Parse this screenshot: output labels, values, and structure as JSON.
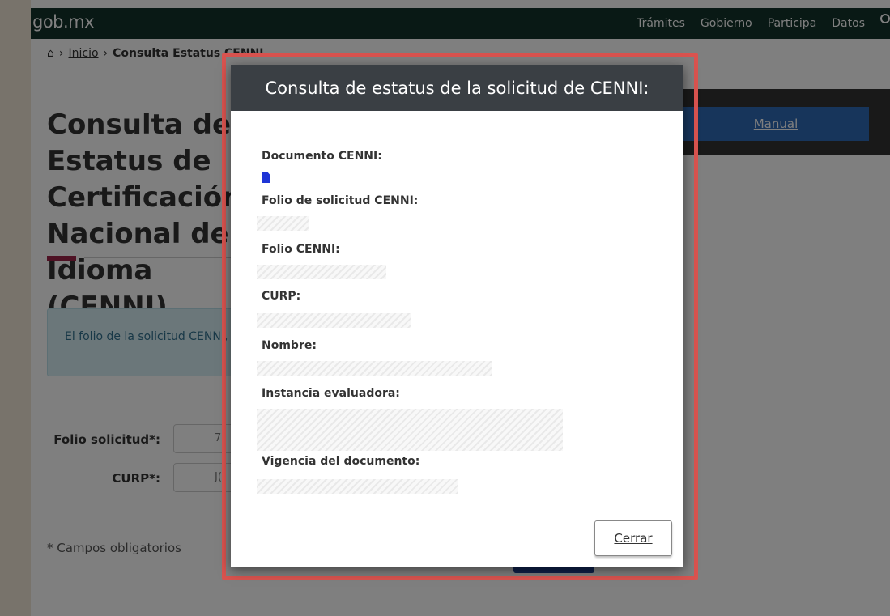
{
  "header": {
    "logo": "gob.mx",
    "nav": [
      "Trámites",
      "Gobierno",
      "Participa",
      "Datos"
    ]
  },
  "breadcrumb": {
    "home": "Inicio",
    "current": "Consulta Estatus CENNI"
  },
  "page": {
    "title": "Consulta de Estatus de Certificación Nacional de Idioma (CENNI)",
    "manual_link": "Manual",
    "info_text": "El folio de la solicitud CENNI, se",
    "folio_label": "Folio solicitud*:",
    "folio_value": "7",
    "curp_label": "CURP*:",
    "curp_value": "J(",
    "required_note": "* Campos obligatorios"
  },
  "modal": {
    "title": "Consulta de estatus de la solicitud de CENNI:",
    "fields": {
      "documento": "Documento CENNI:",
      "folio_solicitud": "Folio de solicitud CENNI:",
      "folio": "Folio CENNI:",
      "curp": "CURP:",
      "nombre": "Nombre:",
      "instancia": "Instancia evaluadora:",
      "vigencia": "Vigencia del documento:"
    },
    "close_label": "Cerrar"
  },
  "colors": {
    "header_bg": "#13322b",
    "modal_header_bg": "#3a3f44",
    "highlight": "#d9534f",
    "doc_icon": "#1f35d6",
    "manual_button": "#2f6bb6",
    "title_accent": "#9d2449"
  }
}
